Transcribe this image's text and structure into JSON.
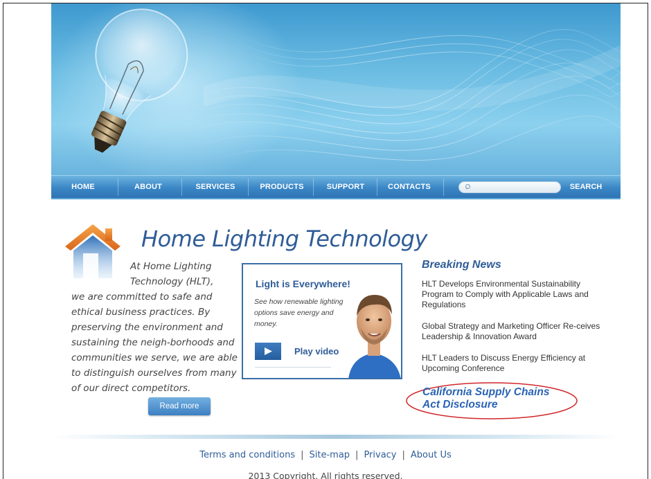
{
  "nav": {
    "items": [
      "HOME",
      "ABOUT",
      "SERVICES",
      "PRODUCTS",
      "SUPPORT",
      "CONTACTS"
    ],
    "search_label": "SEARCH",
    "search_placeholder": ""
  },
  "main": {
    "title": "Home Lighting Technology",
    "intro_first": "At Home Lighting Technology (HLT),",
    "intro_rest": "we are committed to safe and ethical business practices. By preserving the environment and sustaining the neigh-borhoods and communities we serve, we are able to distinguish ourselves from many of our direct competitors.",
    "read_more": "Read more"
  },
  "promo": {
    "title": "Light is Everywhere!",
    "subtitle": "See how renewable lighting options save energy and money.",
    "play_label": "Play video"
  },
  "news": {
    "heading": "Breaking News",
    "items": [
      "HLT Develops Environmental Sustainability Program to Comply with Applicable Laws and Regulations",
      "Global Strategy and Marketing Officer Re-ceives Leadership & Innovation Award",
      "HLT Leaders to Discuss Energy Efficiency at Upcoming Conference"
    ],
    "ca_link": "California Supply Chains Act Disclosure"
  },
  "footer": {
    "links": [
      "Terms and conditions",
      "Site-map",
      "Privacy",
      "About Us"
    ],
    "copyright": "2013 Copyright. All rights reserved."
  },
  "colors": {
    "brand_blue": "#2f5c97",
    "nav_blue": "#3a86c6",
    "oval_red": "#d0262a"
  },
  "icons": [
    "light-bulb-icon",
    "house-icon",
    "search-icon",
    "play-icon"
  ]
}
